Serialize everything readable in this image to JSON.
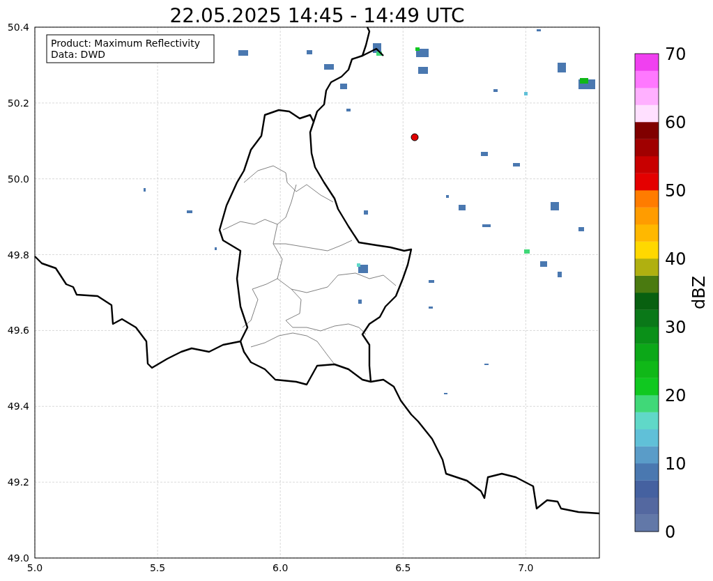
{
  "title": "22.05.2025 14:45 - 14:49 UTC",
  "legend": {
    "lines": [
      "Product: Maximum Reflectivity",
      "Data: DWD"
    ]
  },
  "map": {
    "x_ticks": [
      "5.0",
      "5.5",
      "6.0",
      "6.5",
      "7.0"
    ],
    "y_ticks": [
      "50.4",
      "50.2",
      "50.0",
      "49.8",
      "49.6",
      "49.4",
      "49.2",
      "49.0"
    ]
  },
  "colorbar": {
    "label": "dBZ",
    "ticks": [
      "70",
      "60",
      "50",
      "40",
      "30",
      "20",
      "10",
      "0"
    ],
    "bins": [
      {
        "color": "#6278a8"
      },
      {
        "color": "#5468a0"
      },
      {
        "color": "#4561a0"
      },
      {
        "color": "#4a78b0"
      },
      {
        "color": "#5a9cc8"
      },
      {
        "color": "#60c0d8"
      },
      {
        "color": "#60d8c8"
      },
      {
        "color": "#40d878"
      },
      {
        "color": "#10c820"
      },
      {
        "color": "#10b818"
      },
      {
        "color": "#0ca818"
      },
      {
        "color": "#0a9018"
      },
      {
        "color": "#0a7818"
      },
      {
        "color": "#086010"
      },
      {
        "color": "#4a7a10"
      },
      {
        "color": "#b0b010"
      },
      {
        "color": "#ffd800"
      },
      {
        "color": "#ffb800"
      },
      {
        "color": "#ff9c00"
      },
      {
        "color": "#ff7c00"
      },
      {
        "color": "#e40000"
      },
      {
        "color": "#c80000"
      },
      {
        "color": "#a00000"
      },
      {
        "color": "#800000"
      },
      {
        "color": "#ffe0ff"
      },
      {
        "color": "#ffb0ff"
      },
      {
        "color": "#ff78ff"
      },
      {
        "color": "#f040f0"
      }
    ]
  }
}
